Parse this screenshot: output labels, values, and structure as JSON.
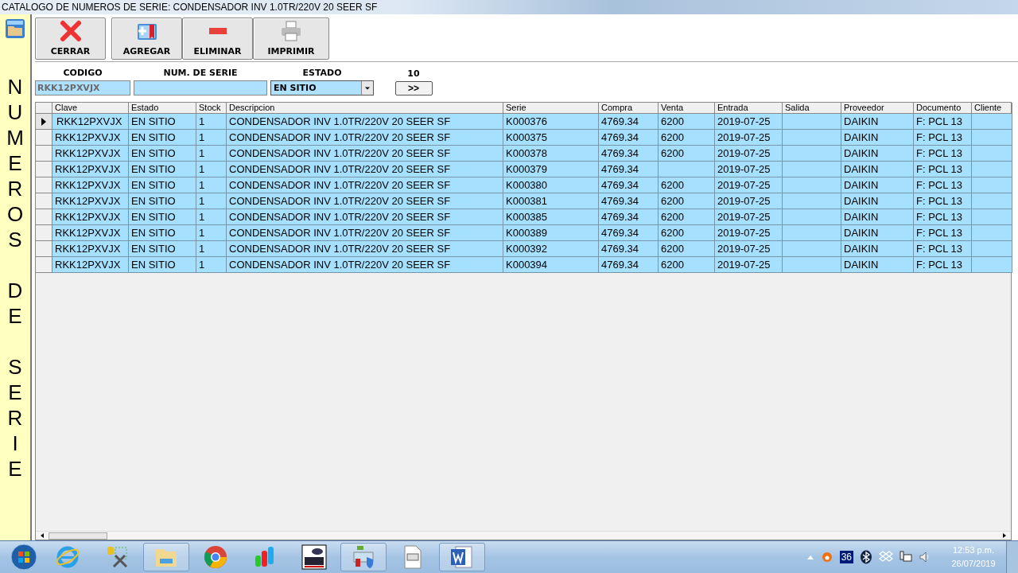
{
  "window": {
    "title": "CATALOGO DE NUMEROS DE SERIE: CONDENSADOR INV 1.0TR/220V 20 SEER SF"
  },
  "side_banner": "NUMEROS DE SERIE",
  "toolbar": [
    {
      "label": "CERRAR",
      "kind": "close"
    },
    {
      "label": "AGREGAR",
      "kind": "add"
    },
    {
      "label": "ELIMINAR",
      "kind": "delete"
    },
    {
      "label": "IMPRIMIR",
      "kind": "print"
    }
  ],
  "filters": {
    "codigo": {
      "label": "CODIGO",
      "value": "RKK12PXVJX",
      "disabled": true
    },
    "num_serie": {
      "label": "NUM. DE SERIE"
    },
    "estado": {
      "label": "ESTADO",
      "value": "EN SITIO"
    },
    "count": "10",
    "next_button": ">>"
  },
  "table": {
    "columns": [
      "Clave",
      "Estado",
      "Stock",
      "Descripcion",
      "Serie",
      "Compra",
      "Venta",
      "Entrada",
      "Salida",
      "Proveedor",
      "Documento",
      "Cliente"
    ],
    "rows": [
      {
        "selected": true,
        "cells": [
          "RKK12PXVJX",
          "EN SITIO",
          "1",
          "CONDENSADOR INV 1.0TR/220V 20 SEER SF",
          "K000376",
          "4769.34",
          "6200",
          "2019-07-25",
          null,
          "DAIKIN",
          "F: PCL 13",
          null
        ]
      },
      {
        "selected": false,
        "cells": [
          "RKK12PXVJX",
          "EN SITIO",
          "1",
          "CONDENSADOR INV 1.0TR/220V 20 SEER SF",
          "K000375",
          "4769.34",
          "6200",
          "2019-07-25",
          null,
          "DAIKIN",
          "F: PCL 13",
          null
        ]
      },
      {
        "selected": false,
        "cells": [
          "RKK12PXVJX",
          "EN SITIO",
          "1",
          "CONDENSADOR INV 1.0TR/220V 20 SEER SF",
          "K000378",
          "4769.34",
          "6200",
          "2019-07-25",
          null,
          "DAIKIN",
          "F: PCL 13",
          null
        ]
      },
      {
        "selected": false,
        "cells": [
          "RKK12PXVJX",
          "EN SITIO",
          "1",
          "CONDENSADOR INV 1.0TR/220V 20 SEER SF",
          "K000379",
          "4769.34",
          null,
          "2019-07-25",
          null,
          "DAIKIN",
          "F: PCL 13",
          null
        ]
      },
      {
        "selected": false,
        "cells": [
          "RKK12PXVJX",
          "EN SITIO",
          "1",
          "CONDENSADOR INV 1.0TR/220V 20 SEER SF",
          "K000380",
          "4769.34",
          "6200",
          "2019-07-25",
          null,
          "DAIKIN",
          "F: PCL 13",
          null
        ]
      },
      {
        "selected": false,
        "cells": [
          "RKK12PXVJX",
          "EN SITIO",
          "1",
          "CONDENSADOR INV 1.0TR/220V 20 SEER SF",
          "K000381",
          "4769.34",
          "6200",
          "2019-07-25",
          null,
          "DAIKIN",
          "F: PCL 13",
          null
        ]
      },
      {
        "selected": false,
        "cells": [
          "RKK12PXVJX",
          "EN SITIO",
          "1",
          "CONDENSADOR INV 1.0TR/220V 20 SEER SF",
          "K000385",
          "4769.34",
          "6200",
          "2019-07-25",
          null,
          "DAIKIN",
          "F: PCL 13",
          null
        ]
      },
      {
        "selected": false,
        "cells": [
          "RKK12PXVJX",
          "EN SITIO",
          "1",
          "CONDENSADOR INV 1.0TR/220V 20 SEER SF",
          "K000389",
          "4769.34",
          "6200",
          "2019-07-25",
          null,
          "DAIKIN",
          "F: PCL 13",
          null
        ]
      },
      {
        "selected": false,
        "cells": [
          "RKK12PXVJX",
          "EN SITIO",
          "1",
          "CONDENSADOR INV 1.0TR/220V 20 SEER SF",
          "K000392",
          "4769.34",
          "6200",
          "2019-07-25",
          null,
          "DAIKIN",
          "F: PCL 13",
          null
        ]
      },
      {
        "selected": false,
        "cells": [
          "RKK12PXVJX",
          "EN SITIO",
          "1",
          "CONDENSADOR INV 1.0TR/220V 20 SEER SF",
          "K000394",
          "4769.34",
          "6200",
          "2019-07-25",
          null,
          "DAIKIN",
          "F: PCL 13",
          null
        ]
      }
    ]
  },
  "taskbar": {
    "tray_badge": "36",
    "time": "12:53 p.m.",
    "date": "26/07/2019"
  }
}
